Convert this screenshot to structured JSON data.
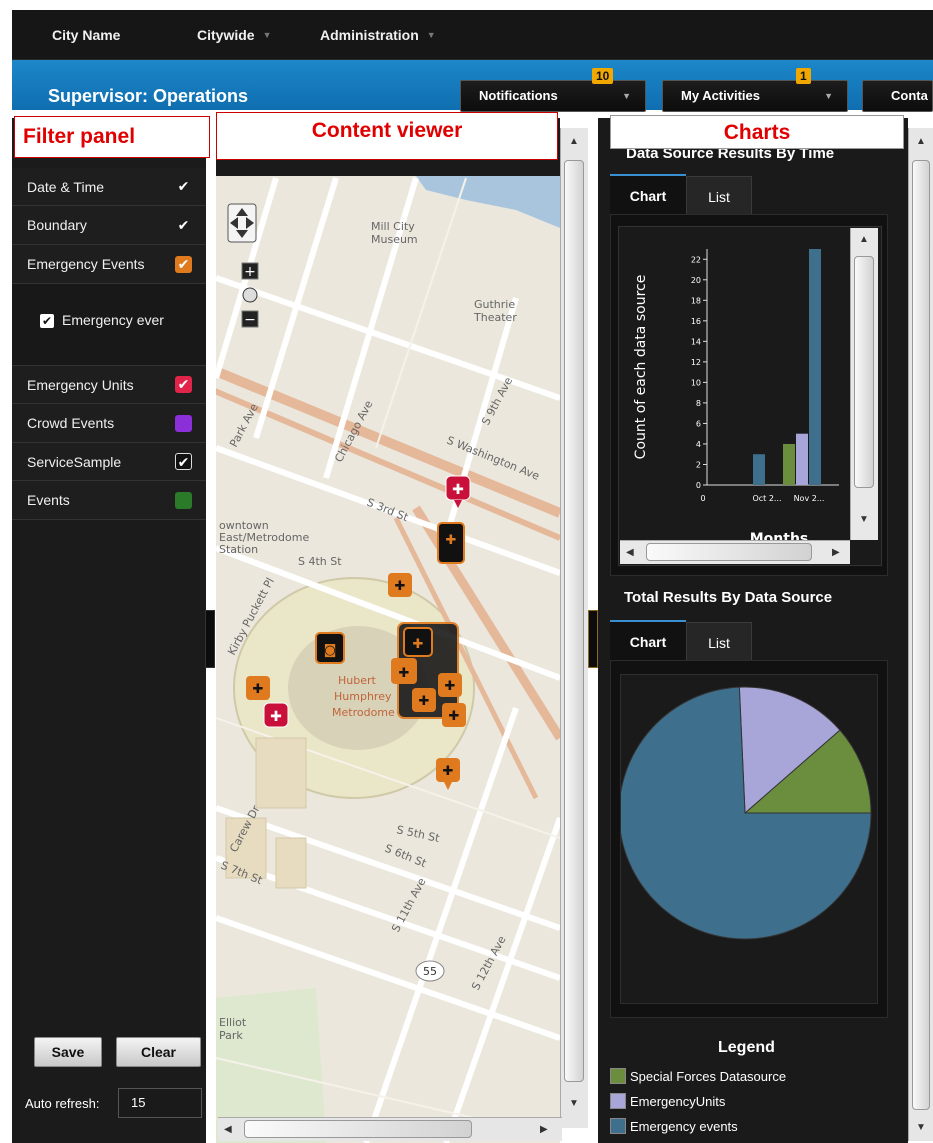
{
  "topbar": {
    "city": "City Name",
    "citywide": "Citywide",
    "administration": "Administration"
  },
  "header": {
    "role": "Supervisor: Operations",
    "notifications": {
      "label": "Notifications",
      "badge": "10"
    },
    "activities": {
      "label": "My Activities",
      "badge": "1"
    },
    "contacts": {
      "label": "Conta"
    }
  },
  "annotations": {
    "filter": "Filter panel",
    "content": "Content viewer",
    "charts": "Charts"
  },
  "filter": {
    "items": [
      {
        "label": "Date & Time",
        "color": "#1e1e1e",
        "checked": true
      },
      {
        "label": "Boundary",
        "color": "#1e1e1e",
        "checked": true
      },
      {
        "label": "Emergency Events",
        "color": "#e07a1f",
        "checked": true
      },
      {
        "label": "Emergency Units",
        "color": "#e0244a",
        "checked": true
      },
      {
        "label": "Crowd Events",
        "color": "#8b2fd8",
        "checked": false
      },
      {
        "label": "ServiceSample",
        "color": "#1e1e1e",
        "checked": true
      },
      {
        "label": "Events",
        "color": "#2a7a2a",
        "checked": false
      }
    ],
    "sublayer": "Emergency ever",
    "save": "Save",
    "clear": "Clear",
    "auto_refresh_label": "Auto refresh:",
    "auto_refresh_value": "15"
  },
  "map": {
    "labels": {
      "mill_city": "Mill City",
      "museum": "Museum",
      "guthrie": "Guthrie",
      "theater": "Theater",
      "park_ave": "Park Ave",
      "chicago_ave": "Chicago Ave",
      "s9th": "S 9th Ave",
      "swash": "S Washington Ave",
      "s3rd": "S 3rd St",
      "downtown": "owntown",
      "east_metro": "East/Metrodome",
      "station": "Station",
      "s4th": "S 4th St",
      "kirby": "Kirby Puckett Pl",
      "hubert": "Hubert",
      "humphrey": "Humphrey",
      "metrodome": "Metrodome",
      "carew": "Carew Dr",
      "s5th": "S 5th St",
      "s6th": "S 6th St",
      "s7th": "S 7th St",
      "s11th": "S 11th Ave",
      "s12th": "S 12th Ave",
      "route": "55",
      "elliot": "Elliot",
      "park": "Park"
    }
  },
  "charts": {
    "time_title": "Data Source Results By Time",
    "tabs": [
      "Chart",
      "List"
    ],
    "total_title": "Total Results By Data Source",
    "legend_title": "Legend"
  },
  "chart_data": [
    {
      "type": "bar",
      "title": "Data Source Results By Time",
      "xlabel": "Months",
      "ylabel": "Count of each data source",
      "categories": [
        "0",
        "Oct 2...",
        "Nov 2..."
      ],
      "yticks": [
        0,
        2,
        4,
        6,
        8,
        10,
        12,
        14,
        16,
        18,
        20,
        22
      ],
      "series": [
        {
          "name": "Emergency events",
          "color": "#3e6f8c",
          "values": [
            0,
            3,
            23
          ]
        },
        {
          "name": "Special Forces Datasource",
          "color": "#6b8e3e",
          "values": [
            0,
            0,
            4
          ]
        },
        {
          "name": "EmergencyUnits",
          "color": "#a8a6d8",
          "values": [
            0,
            0,
            5
          ]
        }
      ],
      "ylim": [
        0,
        23
      ]
    },
    {
      "type": "pie",
      "title": "Total Results By Data Source",
      "slices": [
        {
          "name": "Special Forces Datasource",
          "color": "#6b8e3e",
          "value": 4
        },
        {
          "name": "EmergencyUnits",
          "color": "#a8a6d8",
          "value": 5
        },
        {
          "name": "Emergency events",
          "color": "#3e6f8c",
          "value": 26
        }
      ],
      "legend": "bottom"
    }
  ]
}
